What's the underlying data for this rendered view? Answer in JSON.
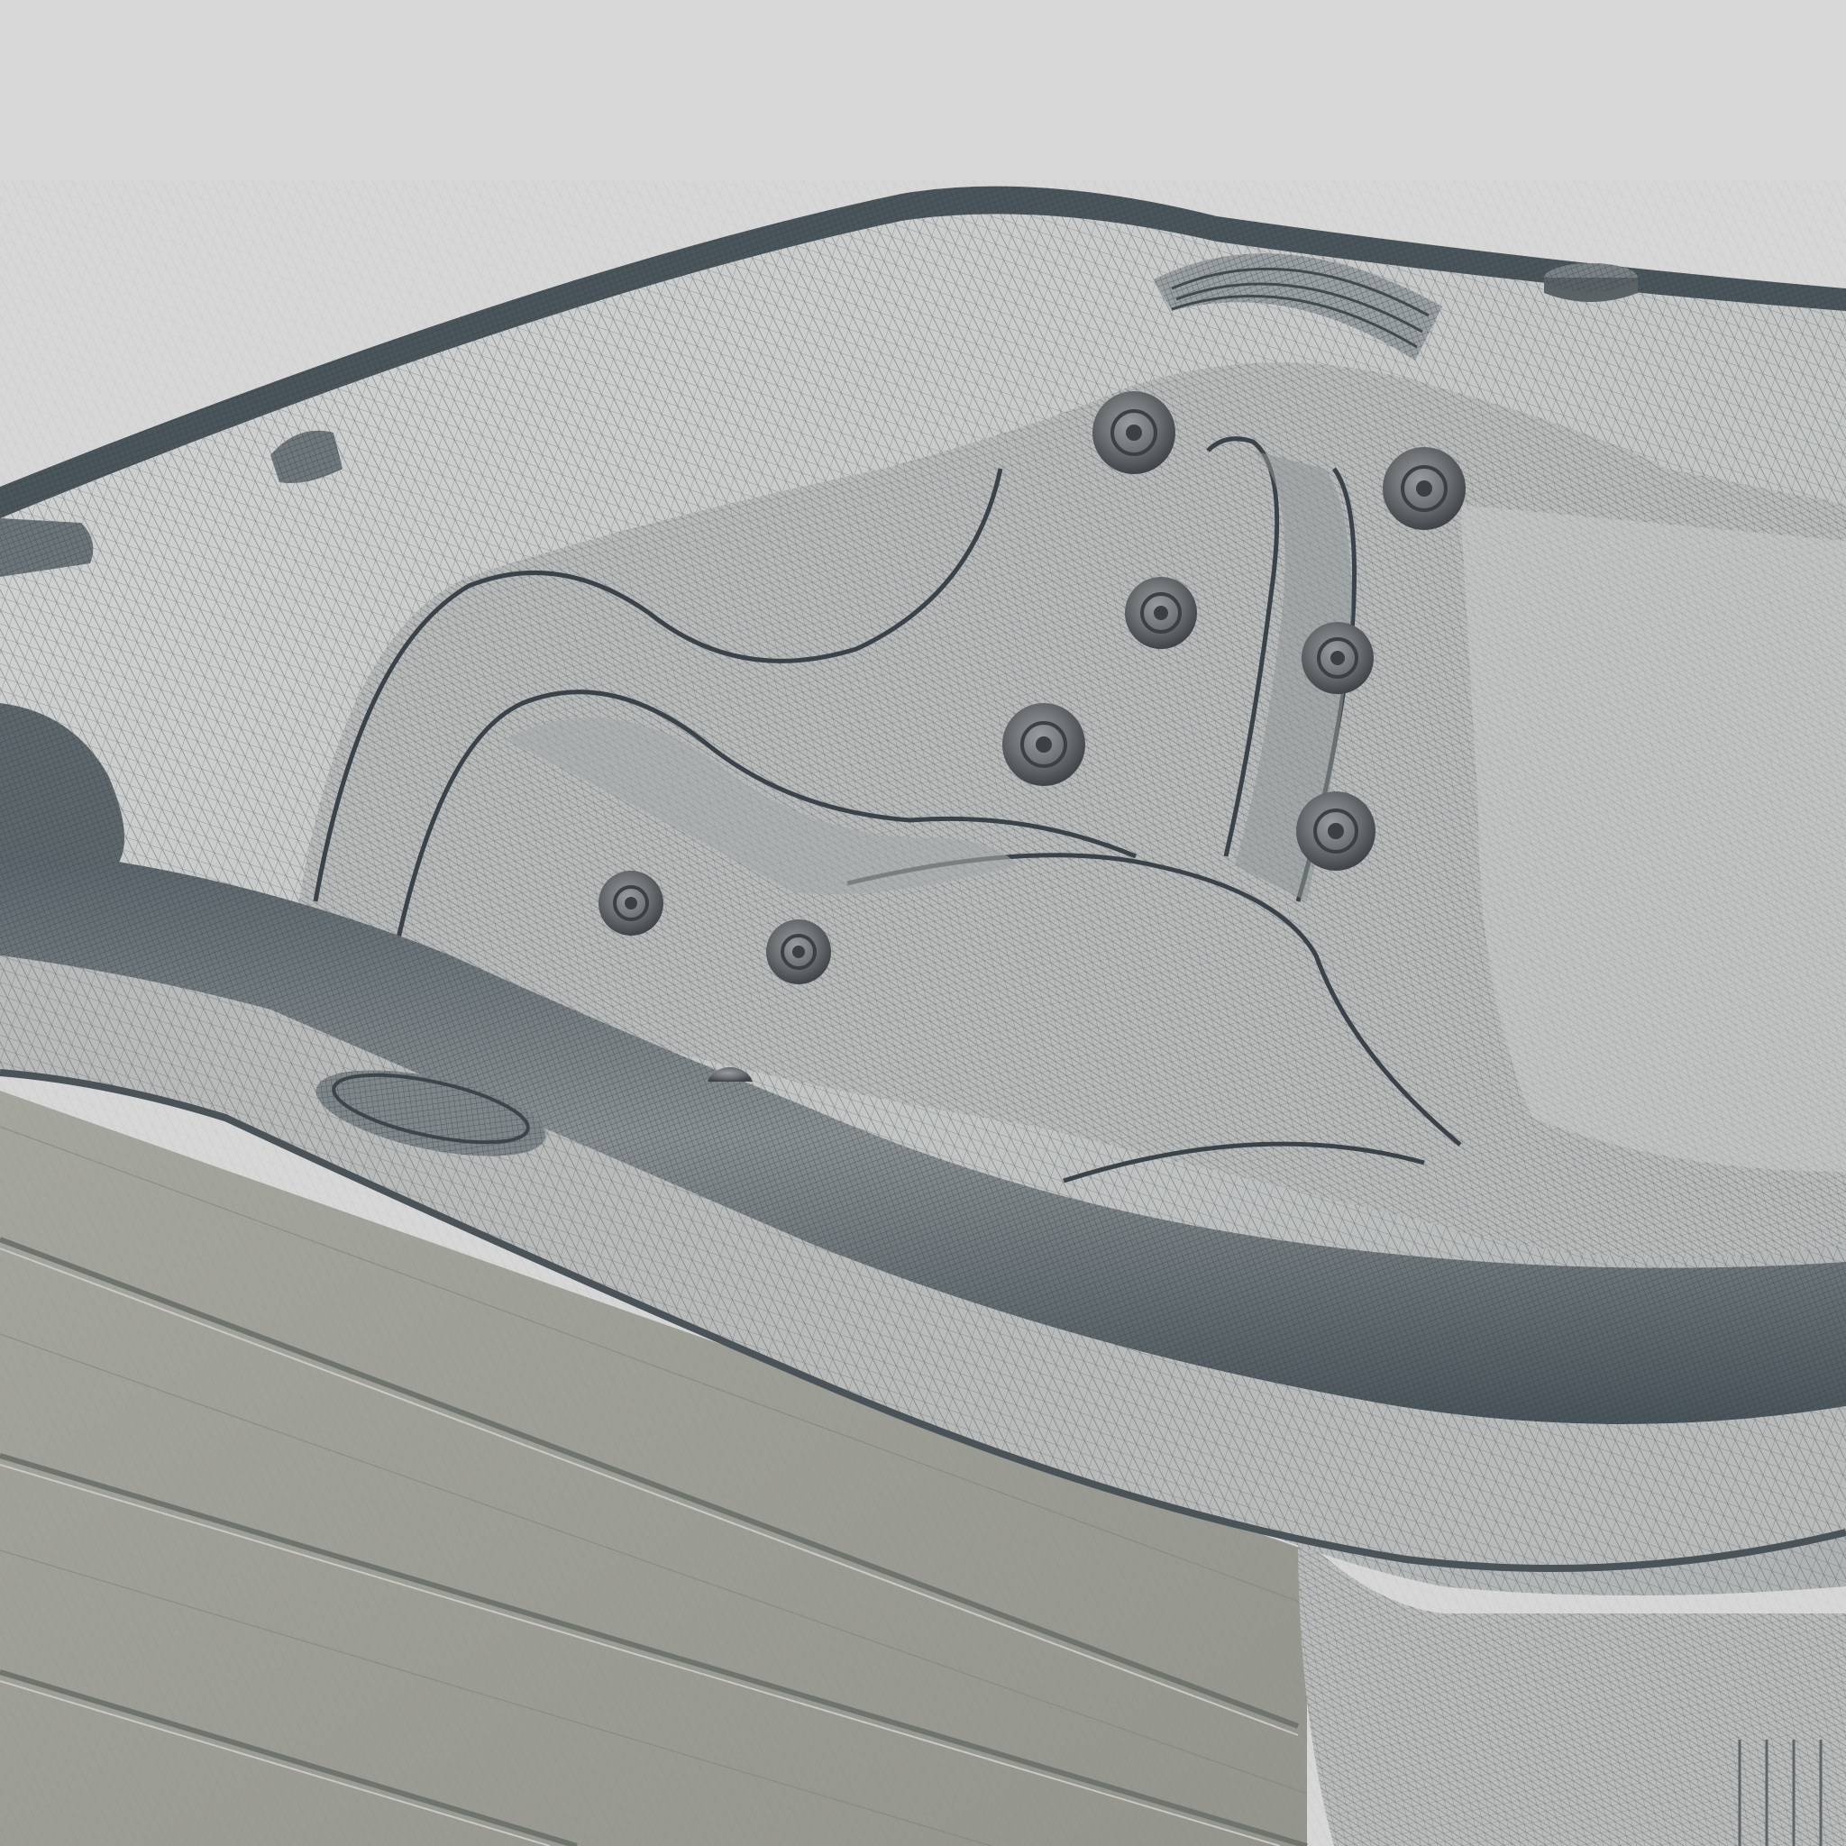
{
  "scene": {
    "subject": "hot-tub-wireframe-render",
    "icons": [
      "jet-nozzle-icon",
      "pillow-headrest-icon",
      "cup-holder-icon",
      "filter-lid-icon",
      "control-nozzle-icon"
    ]
  },
  "colors": {
    "background": "#d6d7d6",
    "shell": "#c3c6c4",
    "shell_shadow": "#a9adac",
    "rim": "#7d8486",
    "rim_dark": "#47535a",
    "cabinet": "#9d9e96",
    "cabinet_line": "#6f746f",
    "wire": "#4a5055",
    "jet_body": "#6e7275",
    "jet_ring": "#3b4044"
  }
}
